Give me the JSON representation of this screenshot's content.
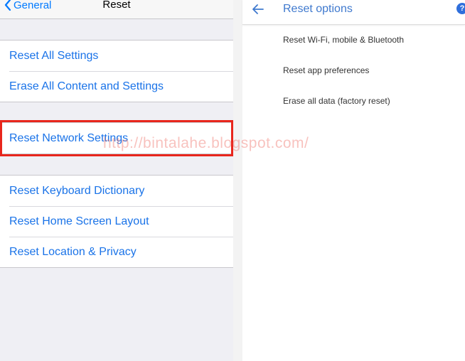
{
  "ios": {
    "back_label": "General",
    "title": "Reset",
    "groups": [
      [
        "Reset All Settings",
        "Erase All Content and Settings"
      ],
      [
        "Reset Network Settings"
      ],
      [
        "Reset Keyboard Dictionary",
        "Reset Home Screen Layout",
        "Reset Location & Privacy"
      ]
    ],
    "colors": {
      "link": "#1a73e8",
      "background": "#efeff4",
      "highlight": "#e8261c"
    }
  },
  "android": {
    "title": "Reset options",
    "help_icon": "?",
    "items": [
      "Reset Wi-Fi, mobile & Bluetooth",
      "Reset app preferences",
      "Erase all data (factory reset)"
    ],
    "colors": {
      "accent": "#3f79ce"
    }
  },
  "watermark": "http://bintalahe.blogspot.com/"
}
